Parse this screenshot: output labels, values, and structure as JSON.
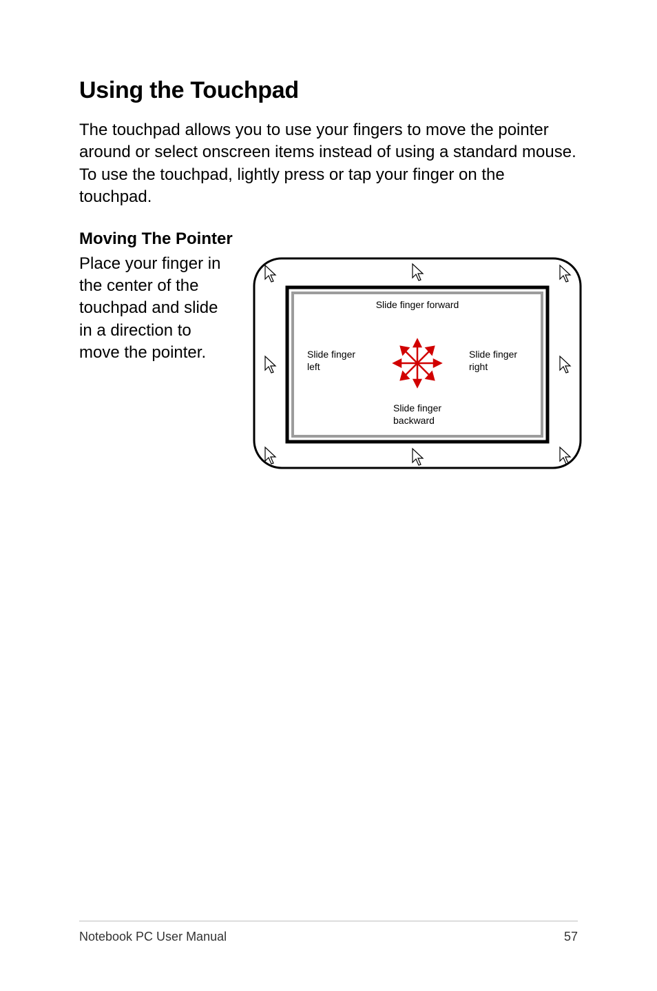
{
  "heading": "Using the Touchpad",
  "intro": "The touchpad allows you to use your fingers to move the pointer around or select onscreen items instead of using a standard mouse. To use the touchpad, lightly press or tap your finger on the touchpad.",
  "subheading": "Moving The Pointer",
  "pointer_instruction": "Place your finger in the center of the touchpad and slide in a direction to move the pointer.",
  "diagram": {
    "forward": "Slide finger forward",
    "left_line1": "Slide finger",
    "left_line2": "left",
    "right_line1": "Slide finger",
    "right_line2": "right",
    "back_line1": "Slide finger",
    "back_line2": "backward"
  },
  "footer": {
    "manual_title": "Notebook PC User Manual",
    "page_number": "57"
  }
}
